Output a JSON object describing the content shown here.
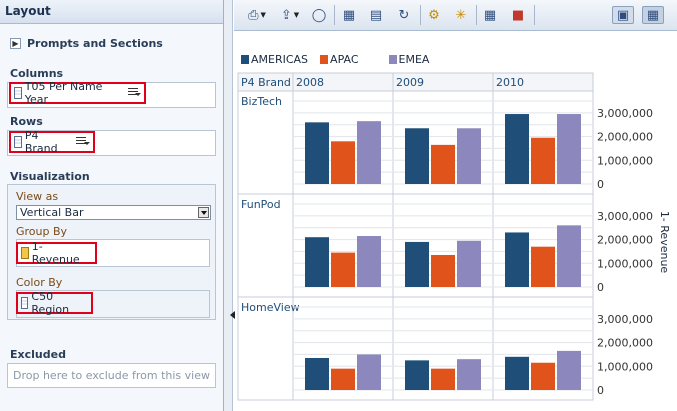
{
  "left_panel": {
    "title": "Layout",
    "prompts_label": "Prompts and Sections",
    "columns": {
      "title": "Columns",
      "item": "T05 Per Name Year"
    },
    "rows": {
      "title": "Rows",
      "item": "P4 Brand"
    },
    "visualization": {
      "title": "Visualization",
      "view_as_label": "View as",
      "view_as_value": "Vertical Bar",
      "group_by_label": "Group By",
      "group_by_item": "1- Revenue",
      "color_by_label": "Color By",
      "color_by_item": "C50 Region"
    },
    "excluded": {
      "title": "Excluded",
      "placeholder": "Drop here to exclude from this view"
    }
  },
  "toolbar": {
    "icons": [
      "print-icon",
      "export-icon",
      "preview-icon",
      "insert-view-icon",
      "prompt-icon",
      "refresh-icon",
      "add-group-icon",
      "calculated-item-icon",
      "format-icon",
      "clear-icon",
      "table-view-icon",
      "chart-properties-icon"
    ]
  },
  "colors": {
    "AMERICAS": "#1f4e79",
    "APAC": "#e0541c",
    "EMEA": "#8c88bd",
    "grid": "#c7ced8"
  },
  "chart_data": {
    "type": "bar",
    "legend": [
      "AMERICAS",
      "APAC",
      "EMEA"
    ],
    "legend_placement": "top-left",
    "row_header": "P4 Brand",
    "columns": [
      "2008",
      "2009",
      "2010"
    ],
    "rows": [
      "BizTech",
      "FunPod",
      "HomeView"
    ],
    "ylabel": "1- Revenue",
    "yticks": [
      "3,000,000",
      "2,000,000",
      "1,000,000",
      "0"
    ],
    "ylim": [
      0,
      3500000
    ],
    "grid": true,
    "values": {
      "BizTech": {
        "2008": [
          2600000,
          1800000,
          2650000
        ],
        "2009": [
          2350000,
          1650000,
          2350000
        ],
        "2010": [
          2950000,
          1950000,
          2950000
        ]
      },
      "FunPod": {
        "2008": [
          2100000,
          1450000,
          2150000
        ],
        "2009": [
          1900000,
          1350000,
          1950000
        ],
        "2010": [
          2300000,
          1700000,
          2600000
        ]
      },
      "HomeView": {
        "2008": [
          1350000,
          900000,
          1500000
        ],
        "2009": [
          1250000,
          900000,
          1300000
        ],
        "2010": [
          1400000,
          1150000,
          1650000
        ]
      }
    }
  }
}
